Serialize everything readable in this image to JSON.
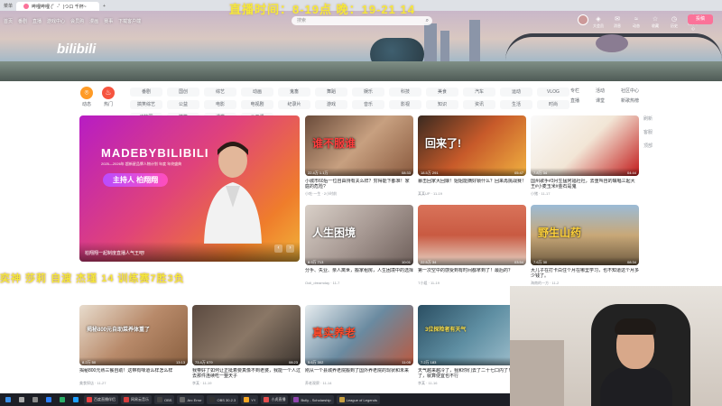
{
  "browser": {
    "tabs": [
      {
        "label": "哔哩哔哩 (゜-゜)つロ 千杯~"
      }
    ],
    "url": "https://www.bilibili.com",
    "toolbar_left": [
      "菜单",
      "+"
    ],
    "bookmarks": [
      "首页",
      "番剧",
      "直播",
      "游戏中心",
      "会员购",
      "漫画",
      "赛事",
      "下载客户端"
    ]
  },
  "overlay": {
    "top_text": "直播时间：8-19点 晚：19-21 14",
    "mid_text": "奕神  莎莉  自渡  杰瑾  14    训练赛7胜3负"
  },
  "nav": {
    "items": [
      "首页",
      "番剧",
      "直播",
      "游戏中心",
      "会员购",
      "漫画",
      "赛事",
      "下载客户端"
    ],
    "search_placeholder": "搜索"
  },
  "right_nav": [
    "大会员",
    "消息",
    "动态",
    "收藏",
    "历史",
    "创作中心"
  ],
  "upload_label": "投稿",
  "logo_text": "bilibili",
  "channels": {
    "dynamic": "动态",
    "hot": "热门",
    "categories": [
      "番剧",
      "国创",
      "综艺",
      "动画",
      "鬼畜",
      "舞蹈",
      "娱乐",
      "科技",
      "美食",
      "汽车",
      "运动",
      "VLOG",
      "搞笑综艺",
      "公益",
      "电影",
      "电视剧",
      "纪录片",
      "游戏",
      "音乐",
      "影视",
      "知识",
      "资讯",
      "生活",
      "时尚",
      "动物圈",
      "搞笑",
      "课堂",
      "公开课"
    ],
    "side_links": [
      "专栏",
      "活动",
      "社区中心",
      "直播",
      "课堂",
      "新歌热榜"
    ]
  },
  "feature": {
    "brand": "MADEBYBILIBILI",
    "subtitle": "2025—2026年 超新星品牌人物计划 年度 年终盛典",
    "host_pill": "主持人 柏翔翔",
    "caption": "柏翔翔一起制度直播人气王吧!",
    "prev": "‹",
    "next": "›"
  },
  "cards": [
    {
      "title": "小城市60后一位自由持有夫么样？穷得能下都准！家庭的危险?",
      "author": "小吃·一生 · 2小时前",
      "stats": "22.4万  1.1万",
      "duration": "08:33",
      "overlay": "谁不服谁"
    },
    {
      "title": "暴击回家大回娘！姐姐能摘好锁什么？回来再挑战赛！",
      "author": "某某UP · 11-19",
      "stats": "18.5万  291",
      "duration": "05:47",
      "overlay": "回来了!"
    },
    {
      "title": "国州歌手#3月生猛阿福社社，去重叫自的嘴唱三起大王#小麦玉米#金石是鬼",
      "author": "小猪 · 11-17",
      "stats": "7.8万  34",
      "duration": "04:44",
      "overlay": ""
    },
    {
      "title": "分手、失业、亲人离世，搬家租房，人生困境中的选择",
      "author": "Ooli_dreamday · 11-7",
      "stats": "8.9万  713",
      "duration": "10:01",
      "overlay": "人生困境"
    },
    {
      "title": "第一次空中的感受到有时间都拿到了！最后的？",
      "author": "T小姐 · 11-19",
      "stats": "22.5万  34",
      "duration": "03:54",
      "overlay": ""
    },
    {
      "title": "大儿子在打卡白住个月在哪里学习，也不知道这个月多少钱了。",
      "author": "海南的一方 · 11-2",
      "stats": "7.6万  30",
      "duration": "08:34",
      "overlay": "野生山药"
    },
    {
      "title": "揭秘800元熟三餐自助！这带有味道么样怎么样",
      "author": "美食探店 · 11-27",
      "stats": "8.2万  50",
      "duration": "13:13",
      "overlay": "揭秘800元自助菜养体重了"
    },
    {
      "title": "我带好了如何让正挺着要真像不到老婆，我能一个人过去那件连续吃一整天子",
      "author": "李某 · 11-19",
      "stats": "73.4万  679",
      "duration": "08:23",
      "overlay": ""
    },
    {
      "title": "刚从一个县城养老院搬到了国外养老院的现状和未来",
      "author": "养老观察 · 11-14",
      "stats": "5.6万  302",
      "duration": "11:05",
      "overlay": "真实养老"
    },
    {
      "title": "天气越来越冷了，我和你们去了二十七口内了！买不了了，就算便宜也不行",
      "author": "李某 · 11-16",
      "stats": "7.2万  183",
      "duration": "05:38",
      "overlay": "3位探险者有天气"
    }
  ],
  "taskbar": {
    "apps": [
      "开始",
      "搜索",
      "任务视图",
      "浏览器",
      "微信",
      "QQ",
      "百度直播伴侣",
      "网易云音乐",
      "OBS",
      "Arc Error",
      "OBS 30.2.3",
      "YY",
      "小虎直播",
      "Bully - Scholarship",
      "League of Legends"
    ]
  },
  "scroll_tools": [
    "刷新",
    "客服",
    "顶部"
  ],
  "colors": {
    "accent": "#fb7299",
    "overlay_text": "#f5e83b",
    "hot": "#f6543f",
    "dynamic": "#ff9b26"
  }
}
